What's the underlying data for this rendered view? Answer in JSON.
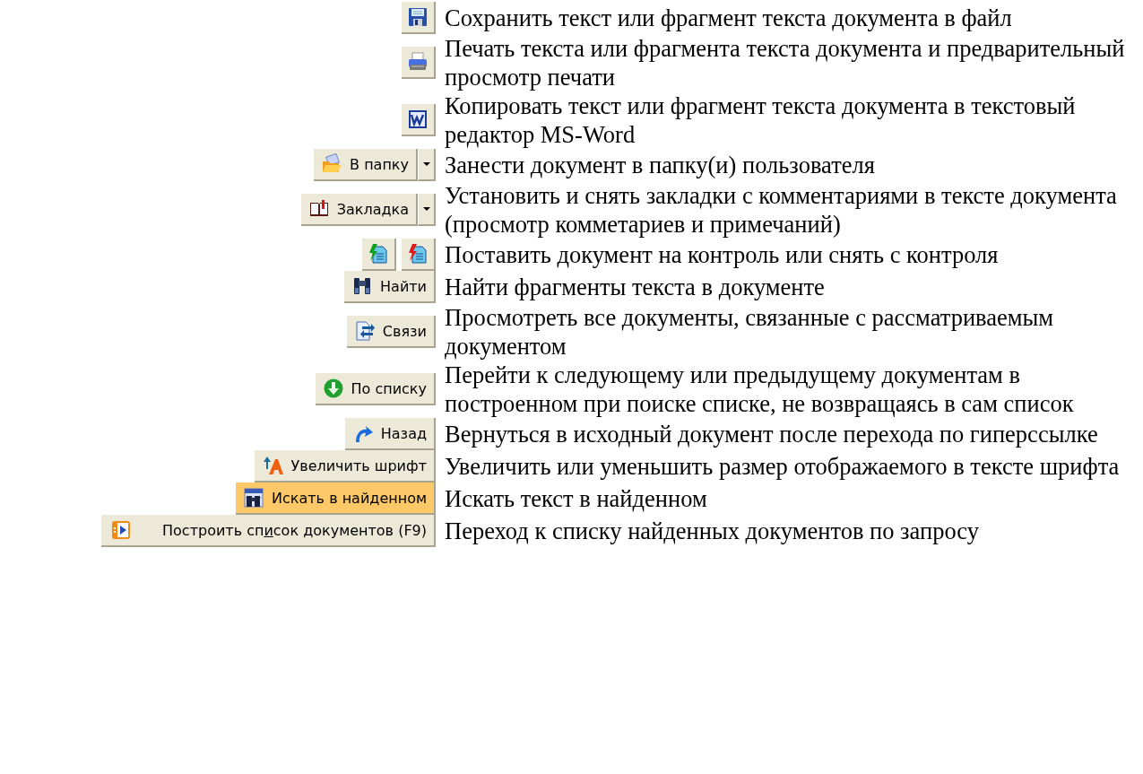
{
  "rows": [
    {
      "buttons": [
        {
          "kind": "icon",
          "highlighted": false
        }
      ],
      "description": "Сохранить текст или фрагмент текста документа в файл"
    },
    {
      "buttons": [
        {
          "kind": "icon",
          "highlighted": false
        }
      ],
      "description": "Печать текста или фрагмента текста документа и предварительный просмотр печати"
    },
    {
      "buttons": [
        {
          "kind": "icon",
          "highlighted": false
        }
      ],
      "description": "Копировать текст или фрагмент текста документа в текстовый редактор MS-Word"
    },
    {
      "buttons": [
        {
          "kind": "split",
          "label": "В папку",
          "highlighted": false
        }
      ],
      "description": "Занести документ в папку(и) пользователя"
    },
    {
      "buttons": [
        {
          "kind": "split",
          "label": "Закладка",
          "highlighted": false
        }
      ],
      "description": "Установить и снять закладки с комментариями в тексте документа (просмотр комметариев и примечаний)"
    },
    {
      "buttons": [
        {
          "kind": "icon",
          "highlighted": false
        },
        {
          "kind": "icon",
          "highlighted": false
        }
      ],
      "description": "Поставить документ на контроль или снять с контроля"
    },
    {
      "buttons": [
        {
          "kind": "labeled",
          "label": "Найти",
          "highlighted": false
        }
      ],
      "description": "Найти фрагменты текста в документе"
    },
    {
      "buttons": [
        {
          "kind": "labeled",
          "label": "Связи",
          "highlighted": false
        }
      ],
      "description": "Просмотреть все документы, связанные с рассматриваемым документом"
    },
    {
      "buttons": [
        {
          "kind": "labeled",
          "label": "По списку",
          "highlighted": false
        }
      ],
      "description": "Перейти к следующему или предыдущему документам в построенном при поиске списке, не возвращаясь в сам список"
    },
    {
      "buttons": [
        {
          "kind": "labeled",
          "label": "Назад",
          "highlighted": false
        }
      ],
      "description": "Вернуться в исходный документ после перехода по гиперссылке"
    },
    {
      "buttons": [
        {
          "kind": "labeled",
          "label": "Увеличить шрифт",
          "highlighted": false
        }
      ],
      "description": "Увеличить или уменьшить размер отображаемого в тексте шрифта"
    },
    {
      "buttons": [
        {
          "kind": "labeled",
          "label": "Искать в найденном",
          "highlighted": true
        }
      ],
      "description": "Искать текст в найденном"
    },
    {
      "buttons": [
        {
          "kind": "wide",
          "label_before": "Построить сп",
          "access_key": "и",
          "label_after": "сок документов (F9)",
          "highlighted": false
        }
      ],
      "description": "Переход к списку найденных документов по запросу"
    }
  ]
}
